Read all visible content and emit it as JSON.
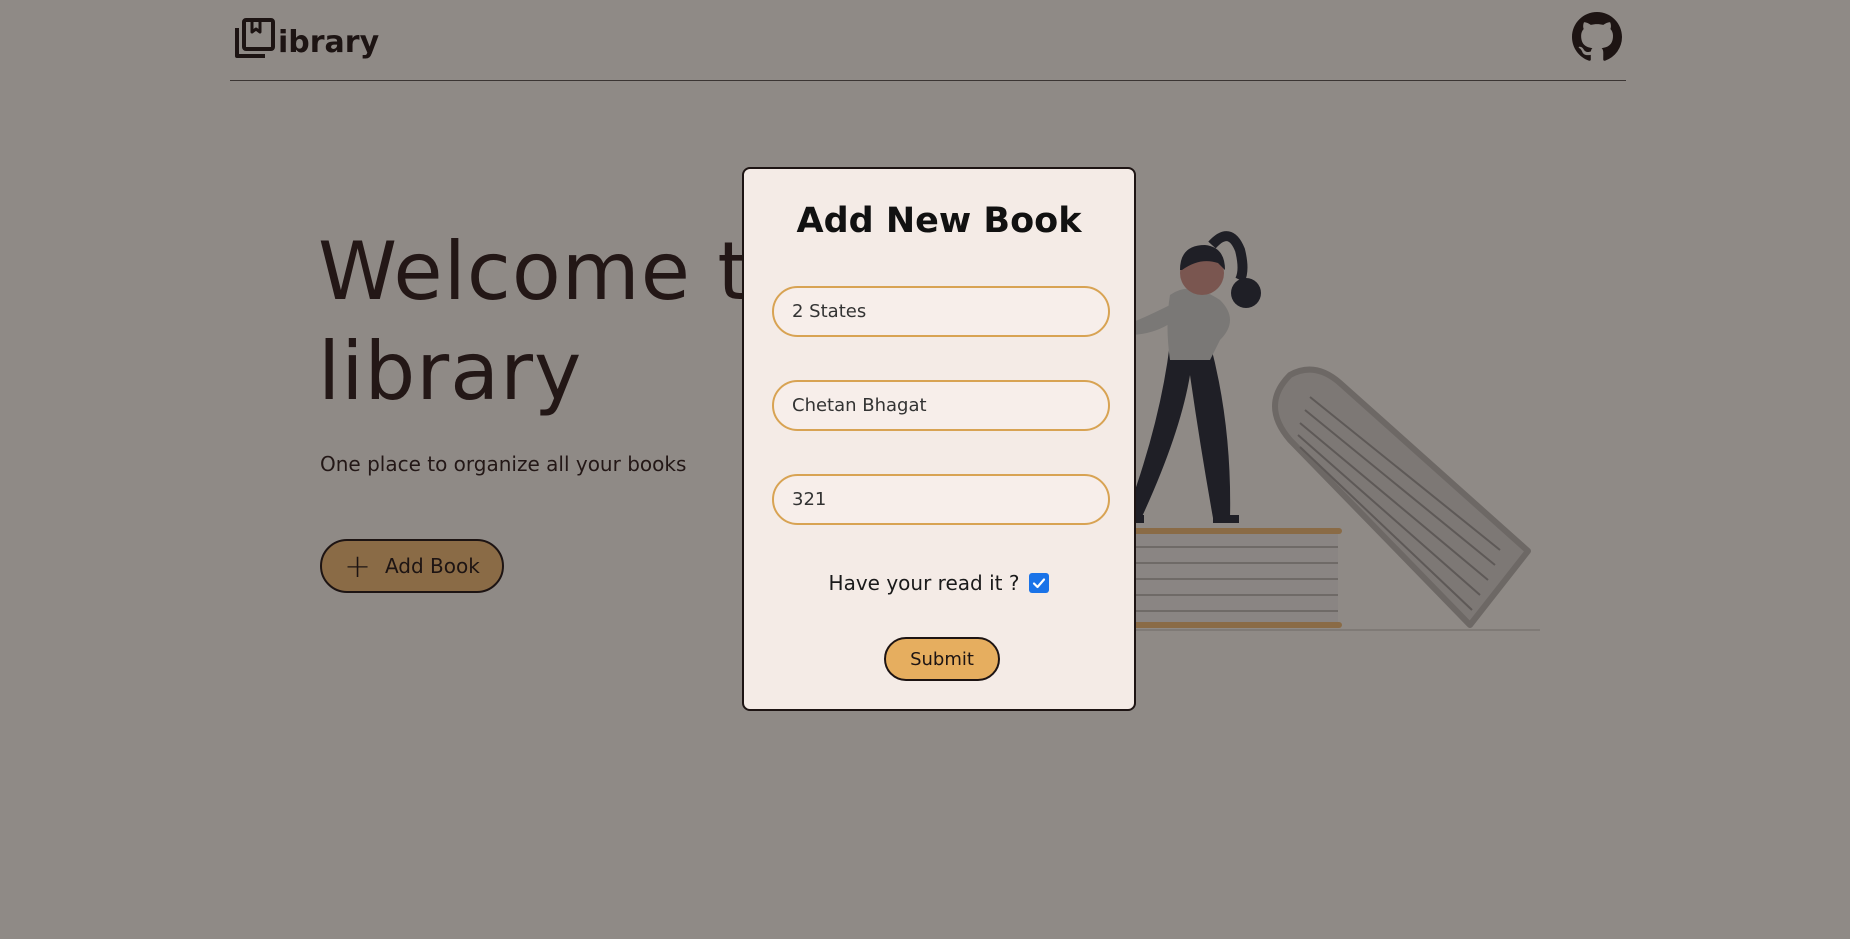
{
  "header": {
    "logo_text": "ibrary",
    "github_icon": "github-icon",
    "logo_icon": "bookmark-stack-icon"
  },
  "hero": {
    "title_line1": "Welcome t",
    "title_line2": "library",
    "subtitle": "One place to organize all your books",
    "add_book_label": "Add Book",
    "add_book_icon": "plus-icon"
  },
  "modal": {
    "title": "Add New Book",
    "fields": {
      "title_value": "2 States",
      "author_value": "Chetan Bhagat",
      "pages_value": "321"
    },
    "read_label": "Have your read it ?",
    "read_checked": true,
    "submit_label": "Submit"
  },
  "colors": {
    "overlay_bg": "#8f8a86",
    "modal_bg": "#f4ebe6",
    "accent": "#e6ae5f",
    "field_border": "#d8a353",
    "text": "#1d1413",
    "checkbox": "#1a73e8"
  }
}
